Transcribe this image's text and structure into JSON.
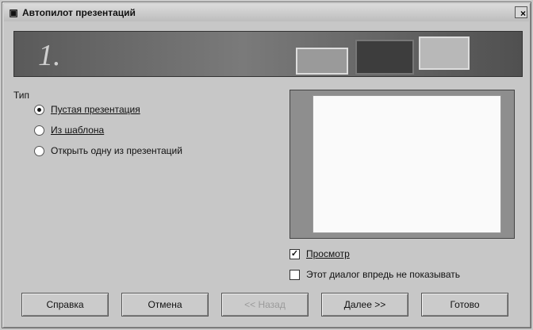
{
  "window": {
    "title": "Автопилот презентаций",
    "close_symbol": "×"
  },
  "banner": {
    "step_number": "1."
  },
  "type_group": {
    "label": "Тип",
    "options": [
      {
        "label": "Пустая презентация",
        "checked": true
      },
      {
        "label": "Из шаблона",
        "checked": false
      },
      {
        "label": "Открыть одну из презентаций",
        "checked": false
      }
    ]
  },
  "preview": {
    "checkbox_label": "Просмотр",
    "checked": true,
    "check_mark": "✓"
  },
  "dont_show": {
    "checkbox_label": "Этот диалог впредь не показывать",
    "checked": false
  },
  "buttons": {
    "help": "Справка",
    "cancel": "Отмена",
    "back": "<< Назад",
    "next": "Далее >>",
    "finish": "Готово"
  },
  "icons": {
    "app_icon": "presentation-app-icon"
  }
}
